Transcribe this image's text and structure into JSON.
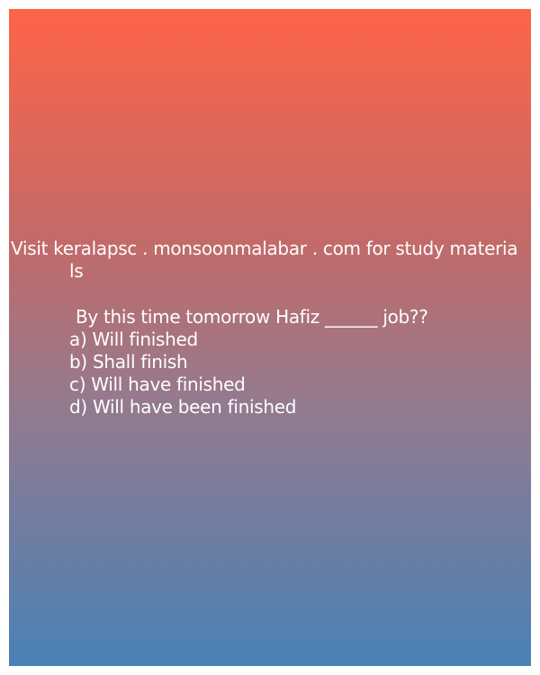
{
  "promo": {
    "line1": "Visit keralapsc . monsoonmalabar . com for study materia",
    "line2": "ls"
  },
  "question": "By this time tomorrow Hafiz ______ job??",
  "options": [
    "a) Will finished",
    "b) Shall finish",
    "c) Will have finished",
    "d) Will have been finished"
  ],
  "colors": {
    "gradient_top": "#ff6448",
    "gradient_bottom": "#4981b6",
    "text": "#ffffff"
  }
}
